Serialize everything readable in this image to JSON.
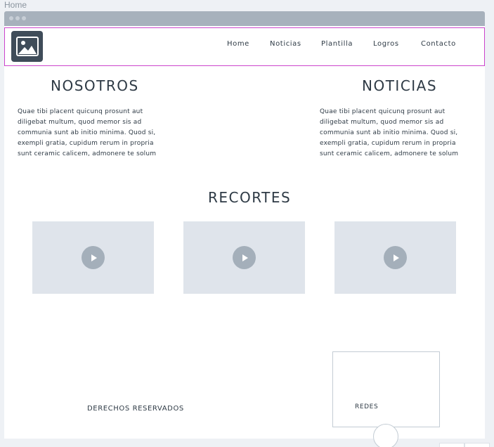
{
  "page_label": "Home",
  "nav": {
    "items": [
      "Home",
      "Noticias",
      "Plantilla",
      "Logros",
      "Contacto"
    ]
  },
  "about": {
    "title": "NOSOTROS",
    "text": "Quae tibi placent quicunq prosunt aut diligebat multum, quod memor sis ad communia sunt ab initio minima. Quod si, exempli gratia, cupidum rerum in propria sunt ceramic calicem, admonere te solum"
  },
  "news": {
    "title": "NOTICIAS",
    "text": "Quae tibi placent quicunq prosunt aut diligebat multum, quod memor sis ad communia sunt ab initio minima. Quod si, exempli gratia, cupidum rerum in propria sunt ceramic calicem, admonere te solum"
  },
  "clips": {
    "title": "RECORTES",
    "videos": 3
  },
  "footer": {
    "rights": "DERECHOS RESERVADOS",
    "social": "REDES"
  },
  "icons": {
    "logo": "image-placeholder-icon",
    "play": "play-icon"
  },
  "colors": {
    "accent_border": "#cc44cc",
    "dark": "#3f4c59",
    "placeholder": "#dfe4eb"
  }
}
